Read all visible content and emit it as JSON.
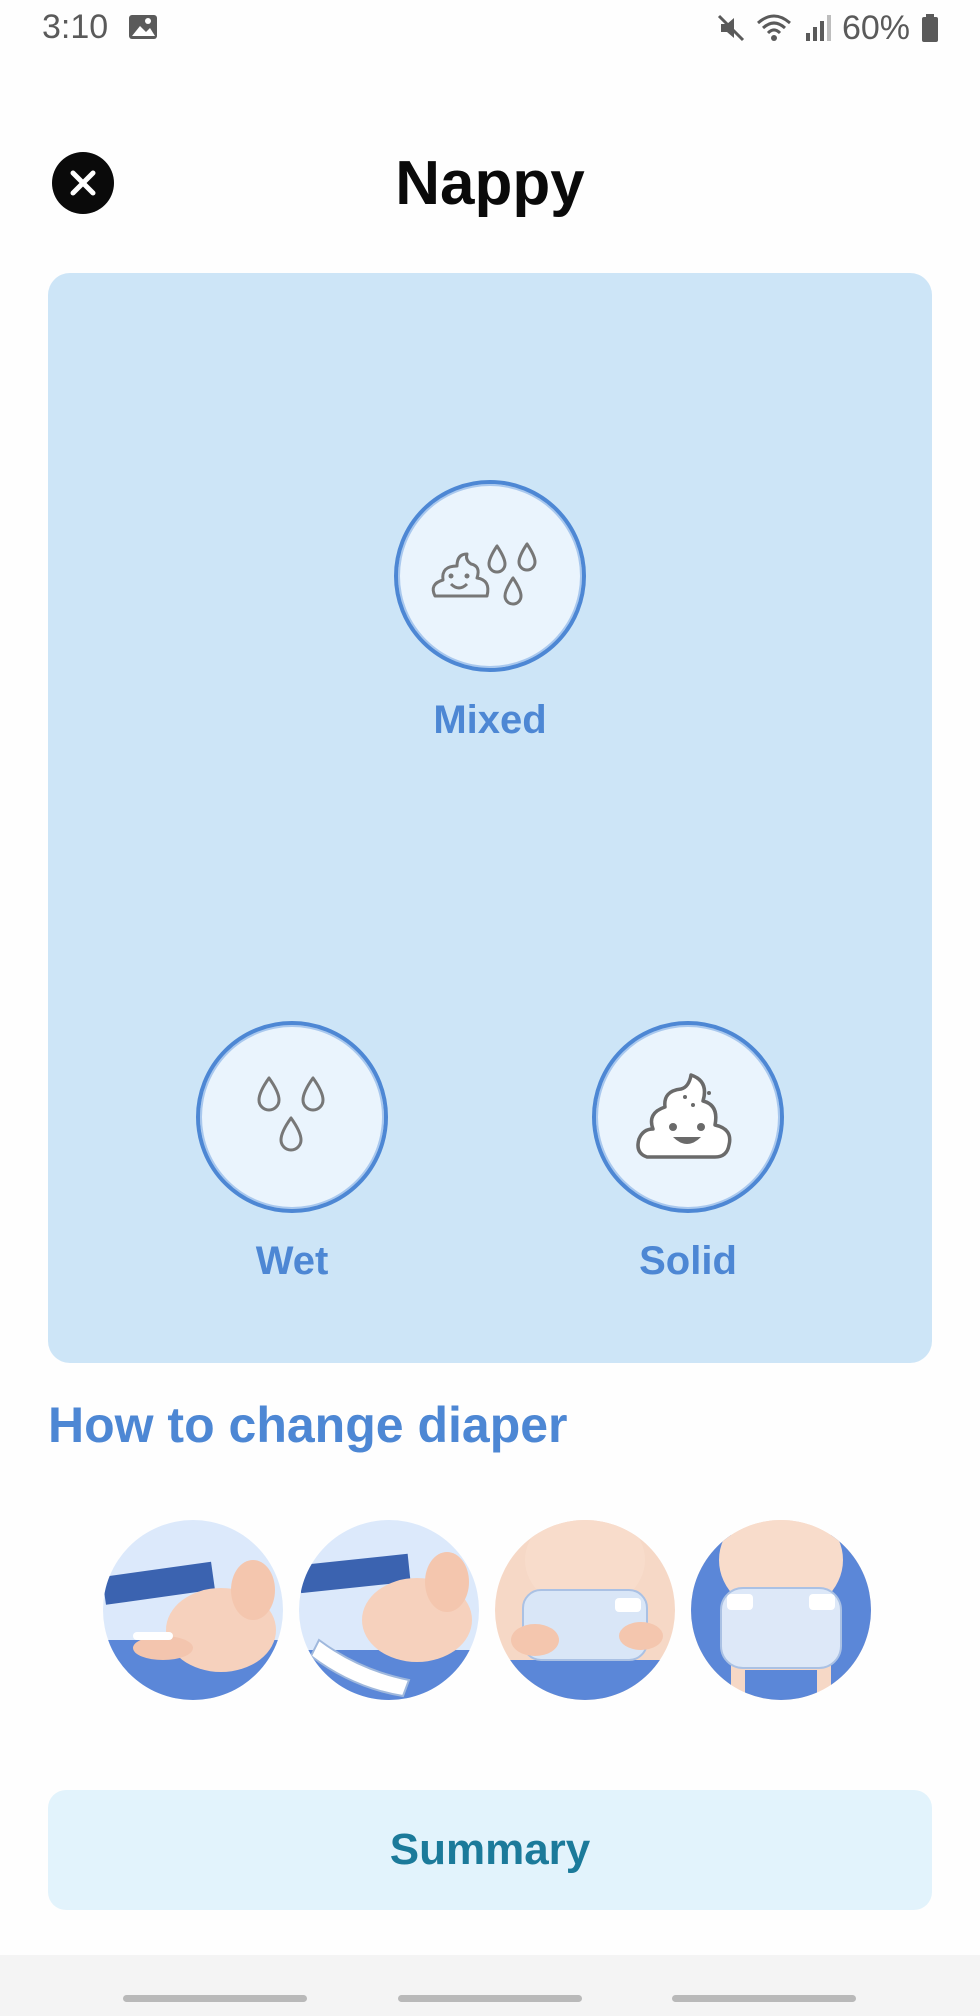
{
  "status_bar": {
    "time": "3:10",
    "battery": "60%",
    "icons": [
      "gallery-icon",
      "mute-icon",
      "wifi-icon",
      "signal-icon",
      "battery-icon"
    ]
  },
  "header": {
    "title": "Nappy",
    "close_icon": "close-icon"
  },
  "options": [
    {
      "label": "Mixed",
      "icon": "mixed-icon"
    },
    {
      "label": "Wet",
      "icon": "drops-icon"
    },
    {
      "label": "Solid",
      "icon": "poop-icon"
    }
  ],
  "howto": {
    "title": "How to change diaper",
    "steps": [
      "step-1-image",
      "step-2-image",
      "step-3-image",
      "step-4-image"
    ]
  },
  "summary_label": "Summary",
  "colors": {
    "accent": "#4d87d4",
    "panel": "#cde5f7",
    "summary_bg": "#e2f3fc",
    "summary_text": "#1b7a9a"
  }
}
